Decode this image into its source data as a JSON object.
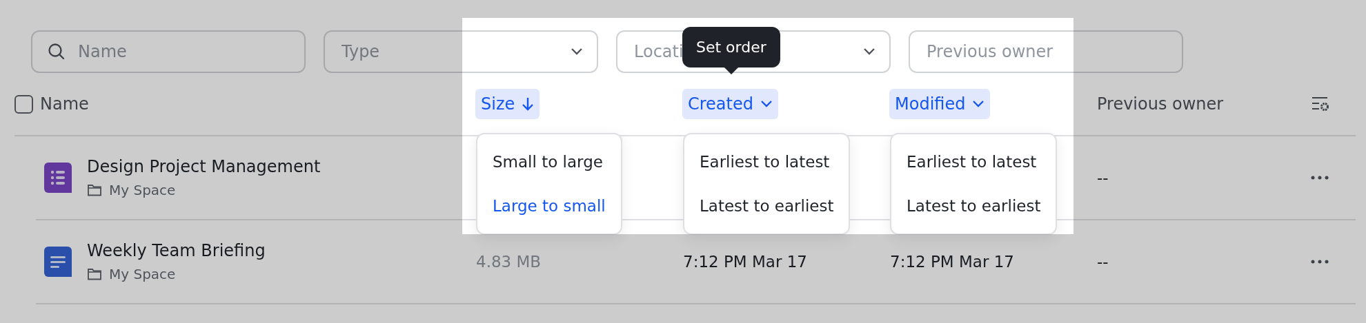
{
  "filters": [
    {
      "kind": "search",
      "placeholder": "Name"
    },
    {
      "kind": "select",
      "placeholder": "Type"
    },
    {
      "kind": "select",
      "placeholder": "Locati"
    },
    {
      "kind": "text",
      "placeholder": "Previous owner"
    }
  ],
  "header": {
    "checked": false,
    "name": "Name",
    "owner": "Previous owner",
    "sort_columns": [
      {
        "label": "Size",
        "sorted": true,
        "open": true,
        "options": [
          {
            "label": "Small to large",
            "selected": false
          },
          {
            "label": "Large to small",
            "selected": true
          }
        ]
      },
      {
        "label": "Created",
        "sorted": false,
        "open": true,
        "tooltip": "Set order",
        "options": [
          {
            "label": "Earliest to latest",
            "selected": false
          },
          {
            "label": "Latest to earliest",
            "selected": false
          }
        ]
      },
      {
        "label": "Modified",
        "sorted": false,
        "open": true,
        "options": [
          {
            "label": "Earliest to latest",
            "selected": false
          },
          {
            "label": "Latest to earliest",
            "selected": false
          }
        ]
      }
    ]
  },
  "rows": [
    {
      "kind": "form",
      "title": "Design Project Management",
      "location": "My Space",
      "owner": "--"
    },
    {
      "kind": "doc",
      "title": "Weekly Team Briefing",
      "location": "My Space",
      "size": "4.83 MB",
      "created": "7:12 PM Mar 17",
      "modified": "7:12 PM Mar 17",
      "owner": "--"
    }
  ]
}
